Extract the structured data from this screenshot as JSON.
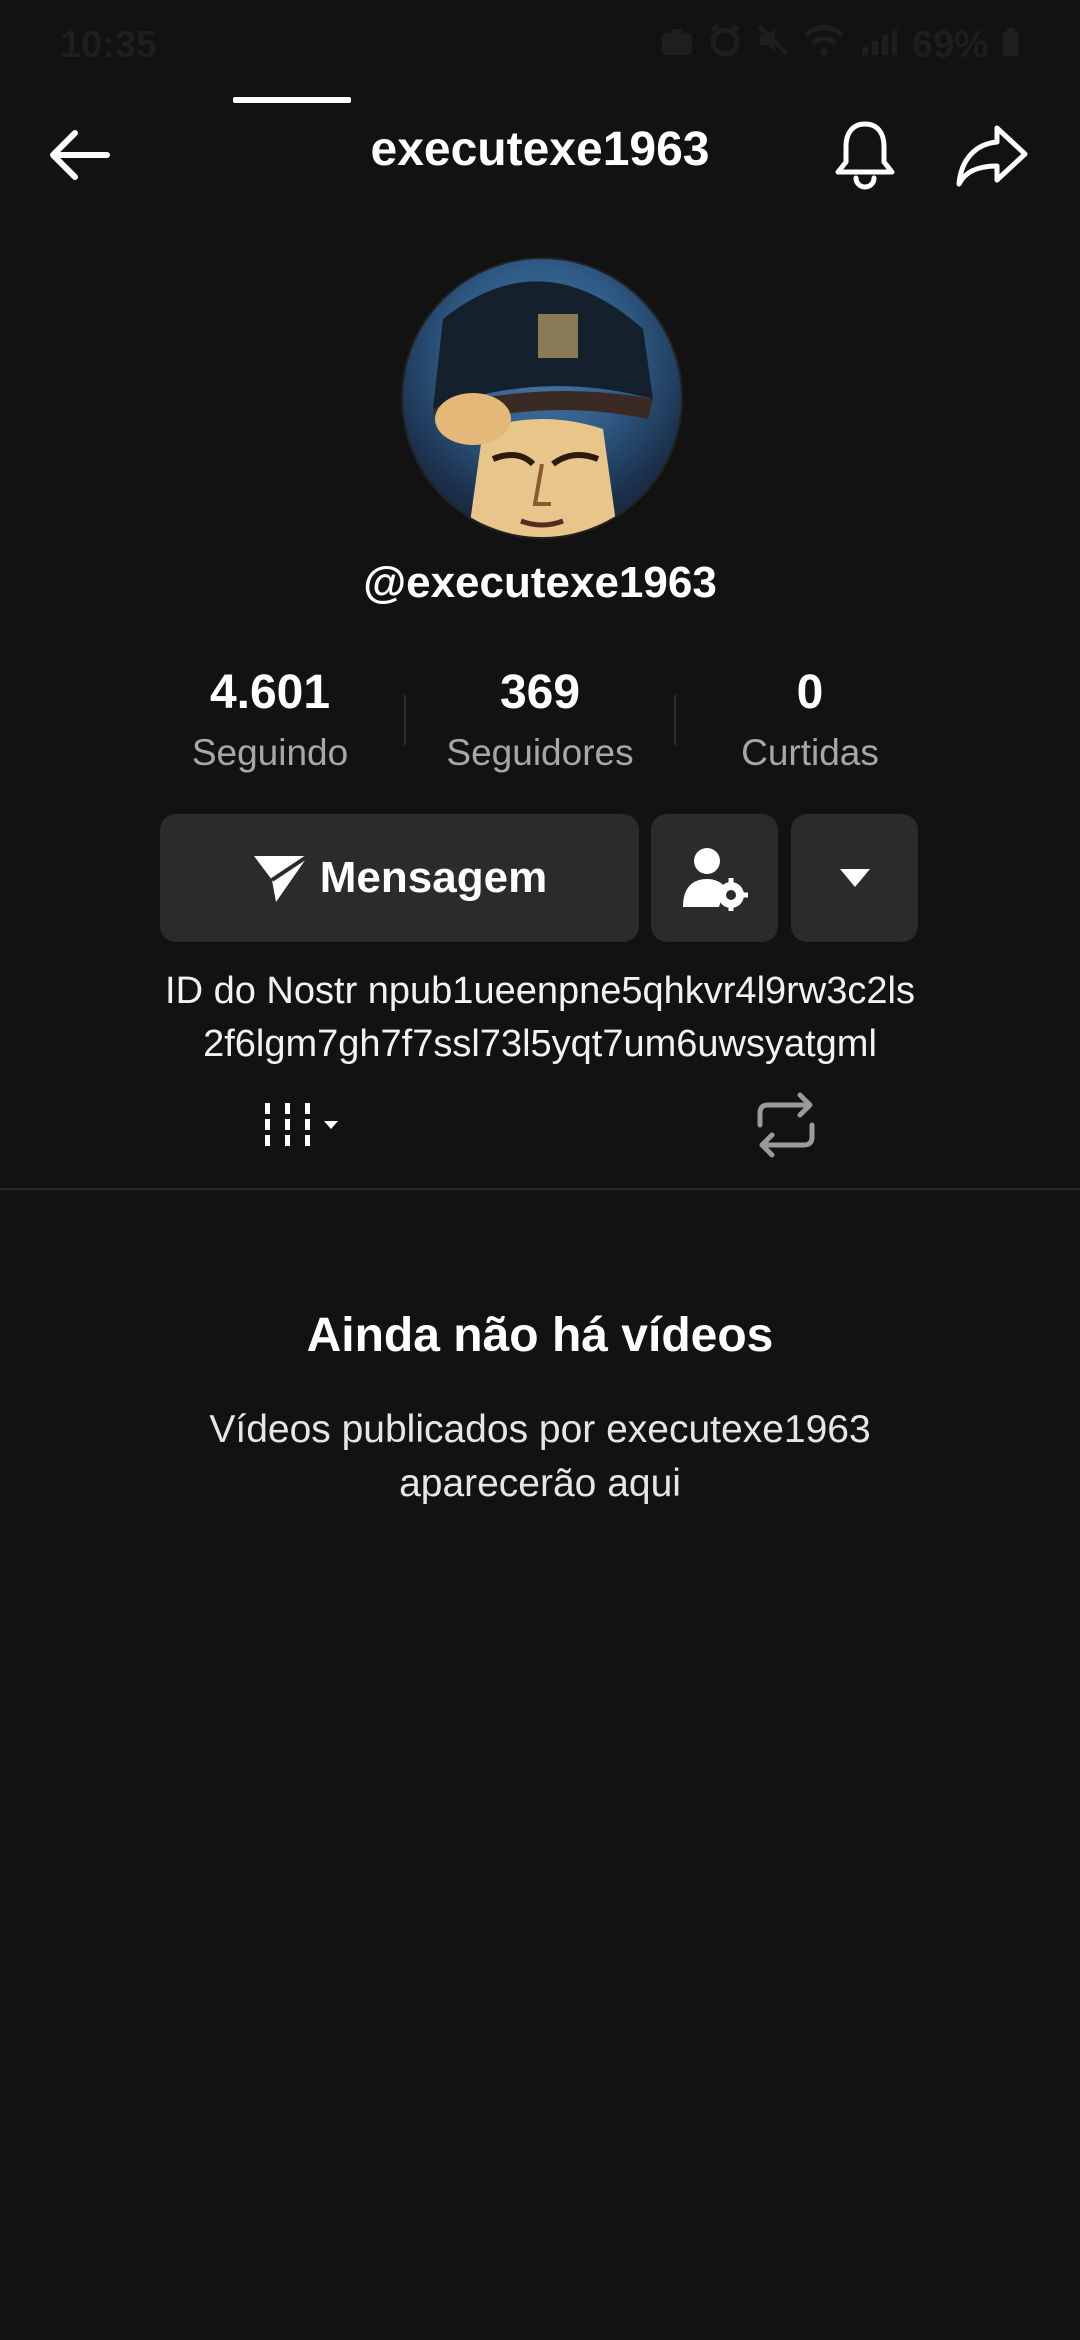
{
  "status_bar": {
    "time": "10:35",
    "battery": "69%"
  },
  "header": {
    "title": "executexe1963"
  },
  "profile": {
    "handle": "@executexe1963"
  },
  "stats": [
    {
      "value": "4.601",
      "label": "Seguindo"
    },
    {
      "value": "369",
      "label": "Seguidores"
    },
    {
      "value": "0",
      "label": "Curtidas"
    }
  ],
  "actions": {
    "message_label": "Mensagem"
  },
  "nostr": {
    "line1": "ID do Nostr npub1ueenpne5qhkvr4l9rw3c2ls",
    "line2": "2f6lgm7gh7f7ssl73l5yqt7um6uwsyatgml"
  },
  "empty_state": {
    "title": "Ainda não há vídeos",
    "line1": "Vídeos publicados por executexe1963",
    "line2": "aparecerão aqui"
  },
  "icons": {
    "back": "arrow-left-icon",
    "bell": "bell-icon",
    "share": "share-icon",
    "message": "send-icon",
    "friend_settings": "user-gear-icon",
    "more": "caret-down-icon",
    "videos_tab": "grid-bars-icon",
    "reposts_tab": "repost-icon"
  },
  "colors": {
    "background": "#121212",
    "button": "#2b2b2b",
    "muted_text": "#a7a7a7"
  }
}
